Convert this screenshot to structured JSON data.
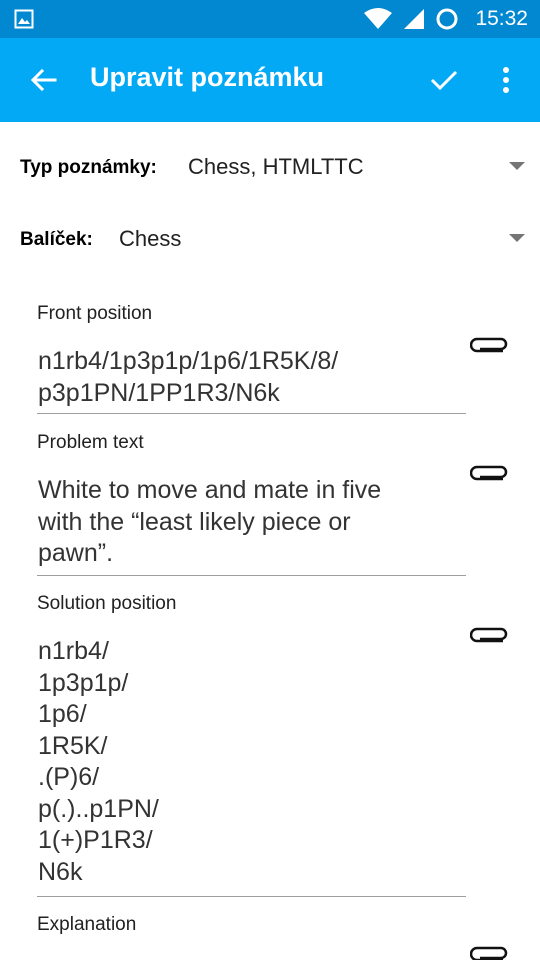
{
  "status_bar": {
    "time": "15:32",
    "icons": [
      "image-icon",
      "wifi-icon",
      "signal-icon",
      "sync-circle-icon"
    ]
  },
  "app_bar": {
    "title": "Upravit poznámku",
    "actions": [
      "back-arrow-icon",
      "check-icon",
      "overflow-menu-icon"
    ]
  },
  "note_type": {
    "label": "Typ poznámky:",
    "value": "Chess, HTMLTTC"
  },
  "deck": {
    "label": "Balíček:",
    "value": "Chess"
  },
  "fields": [
    {
      "label": "Front position",
      "value": "n1rb4/1p3p1p/1p6/1R5K/8/\np3p1PN/1PP1R3/N6k"
    },
    {
      "label": "Problem text",
      "value": "White to move and mate in five\nwith the “least likely piece or\npawn”."
    },
    {
      "label": "Solution position",
      "value": "n1rb4/\n1p3p1p/\n1p6/\n1R5K/\n.(P)6/\np(.)..p1PN/\n1(+)P1R3/\nN6k"
    },
    {
      "label": "Explanation",
      "value": ""
    }
  ],
  "colors": {
    "status_bar": "#0288d1",
    "app_bar": "#03a9f4"
  }
}
